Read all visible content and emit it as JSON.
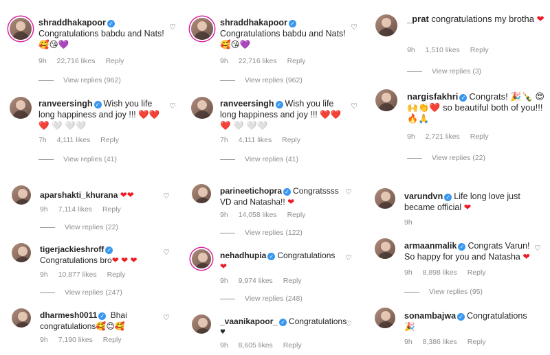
{
  "colors": {
    "verified": "#3897f0",
    "heart": "#ed1c24",
    "muted": "#8e8e8e",
    "text": "#262626"
  },
  "icons": {
    "verified": "✓",
    "like": "♡",
    "heart": "❤"
  },
  "panels": {
    "p1": {
      "c1": {
        "username": "shraddhakapoor",
        "text": "Congratulations babdu and Nats!",
        "emoji": "🥰😘💜",
        "time": "9h",
        "likes": "22,716 likes",
        "reply": "Reply",
        "view_replies": "View replies (962)"
      },
      "c2": {
        "username": "ranveersingh",
        "text": "Wish you life long happiness and joy !!! ❤️❤️❤️ 🤍 🤍🤍",
        "time": "7h",
        "likes": "4,111 likes",
        "reply": "Reply",
        "view_replies": "View replies (41)"
      }
    },
    "p2": {
      "c1": {
        "username": "shraddhakapoor",
        "text": "Congratulations babdu and Nats!",
        "emoji": "🥰😘💜",
        "time": "9h",
        "likes": "22,716 likes",
        "reply": "Reply",
        "view_replies": "View replies (962)"
      },
      "c2": {
        "username": "ranveersingh",
        "text": "Wish you life long happiness and joy !!! ❤️❤️❤️ 🤍 🤍🤍",
        "time": "7h",
        "likes": "4,111 likes",
        "reply": "Reply",
        "view_replies": "View replies (41)"
      }
    },
    "p3": {
      "c1": {
        "username": "_prat",
        "text": "congratulations my brotha",
        "time": "9h",
        "likes": "1,510 likes",
        "reply": "Reply",
        "view_replies": "View replies (3)"
      },
      "c2": {
        "username": "nargisfakhri",
        "text": "Congrats! 🎉🍾 😍🙌👏❤️ so beautiful both of you!!! 🔥🙏",
        "time": "9h",
        "likes": "2,721 likes",
        "reply": "Reply",
        "view_replies": "View replies (22)"
      }
    },
    "p4": {
      "c1": {
        "username": "aparshakti_khurana",
        "time": "9h",
        "likes": "7,114 likes",
        "reply": "Reply",
        "view_replies": "View replies (22)"
      },
      "c2": {
        "username": "tigerjackieshroff",
        "text": "Congratulations bro",
        "time": "9h",
        "likes": "10,877 likes",
        "reply": "Reply",
        "view_replies": "View replies (247)"
      },
      "c3": {
        "username": "dharmesh0011",
        "text": "Bhai congratulations",
        "emoji": "🥰😊🥰",
        "time": "9h",
        "likes": "7,190 likes",
        "reply": "Reply"
      }
    },
    "p5": {
      "c1": {
        "username": "parineetichopra",
        "text": "Congratssss VD and Natasha!!",
        "time": "9h",
        "likes": "14,058 likes",
        "reply": "Reply",
        "view_replies": "View replies (122)"
      },
      "c2": {
        "username": "nehadhupia",
        "text": "Congratulations",
        "time": "9h",
        "likes": "9,974 likes",
        "reply": "Reply",
        "view_replies": "View replies (248)"
      },
      "c3": {
        "username": "_vaanikapoor_",
        "text": "Congratulations",
        "time": "9h",
        "likes": "8,605 likes",
        "reply": "Reply"
      }
    },
    "p6": {
      "c1": {
        "username": "varundvn",
        "text": "Life long love just became official",
        "time": "9h"
      },
      "c2": {
        "username": "armaanmalik",
        "text": "Congrats Varun! So happy for you and Natasha",
        "time": "9h",
        "likes": "8,898 likes",
        "reply": "Reply",
        "view_replies": "View replies (95)"
      },
      "c3": {
        "username": "sonambajwa",
        "text": "Congratulations",
        "time": "9h",
        "likes": "8,386 likes",
        "reply": "Reply"
      }
    }
  }
}
